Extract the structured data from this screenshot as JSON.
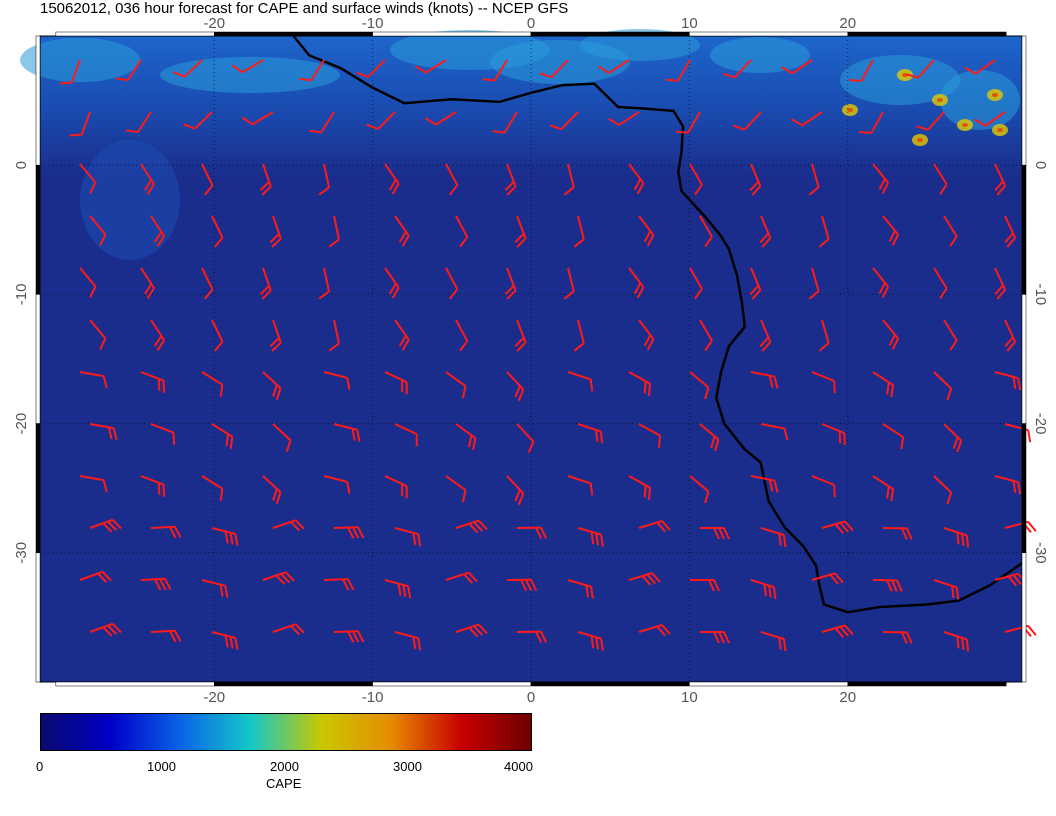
{
  "title": "15062012, 036 hour forecast for CAPE and surface winds (knots) -- NCEP GFS",
  "map": {
    "lon_range": [
      -31,
      31
    ],
    "lat_range": [
      -40,
      10
    ],
    "lon_ticks": [
      "-20",
      "-10",
      "0",
      "10",
      "20"
    ],
    "lon_tick_values": [
      -20,
      -10,
      0,
      10,
      20
    ],
    "lat_ticks": [
      "0",
      "-10",
      "-20",
      "-30"
    ],
    "lat_tick_values": [
      0,
      -10,
      -20,
      -30
    ],
    "ocean_color": "#1a2d8c",
    "coast_color": "#000000",
    "barb_color": "#ff1a1a",
    "grid": "dotted"
  },
  "colorbar": {
    "label": "CAPE",
    "ticks": [
      "0",
      "1000",
      "2000",
      "3000",
      "4000"
    ],
    "range": [
      0,
      4000
    ],
    "colors": [
      "#0a0a6e",
      "#0000c8",
      "#0a64e6",
      "#14c8c8",
      "#c8c800",
      "#e68c00",
      "#c80000",
      "#6e0000"
    ]
  }
}
